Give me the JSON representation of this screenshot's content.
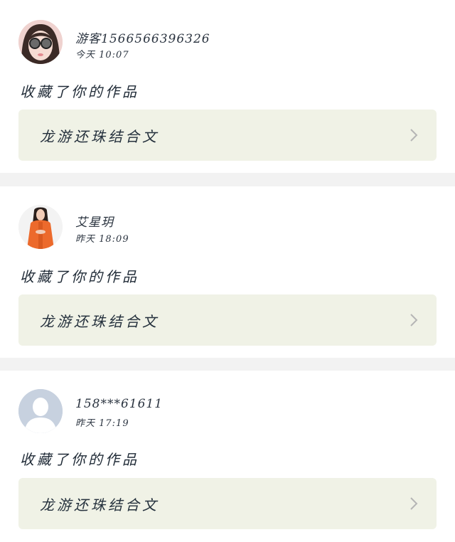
{
  "feed": {
    "items": [
      {
        "user": "游客1566566396326",
        "time": "今天 10:07",
        "action": "收藏了你的作品",
        "work_title": "龙游还珠结合文",
        "avatar_icon": "girl-with-glasses-avatar"
      },
      {
        "user": "艾星玥",
        "time": "昨天 18:09",
        "action": "收藏了你的作品",
        "work_title": "龙游还珠结合文",
        "avatar_icon": "girl-orange-jacket-avatar"
      },
      {
        "user": "158***61611",
        "time": "昨天 17:19",
        "action": "收藏了你的作品",
        "work_title": "龙游还珠结合文",
        "avatar_icon": "default-person-avatar"
      }
    ],
    "colors": {
      "card_bg": "#ffffff",
      "separator": "#f2f2f2",
      "work_box_bg": "#f0f2e6",
      "text": "#1f2a36",
      "chevron": "#b5b5b5"
    }
  }
}
